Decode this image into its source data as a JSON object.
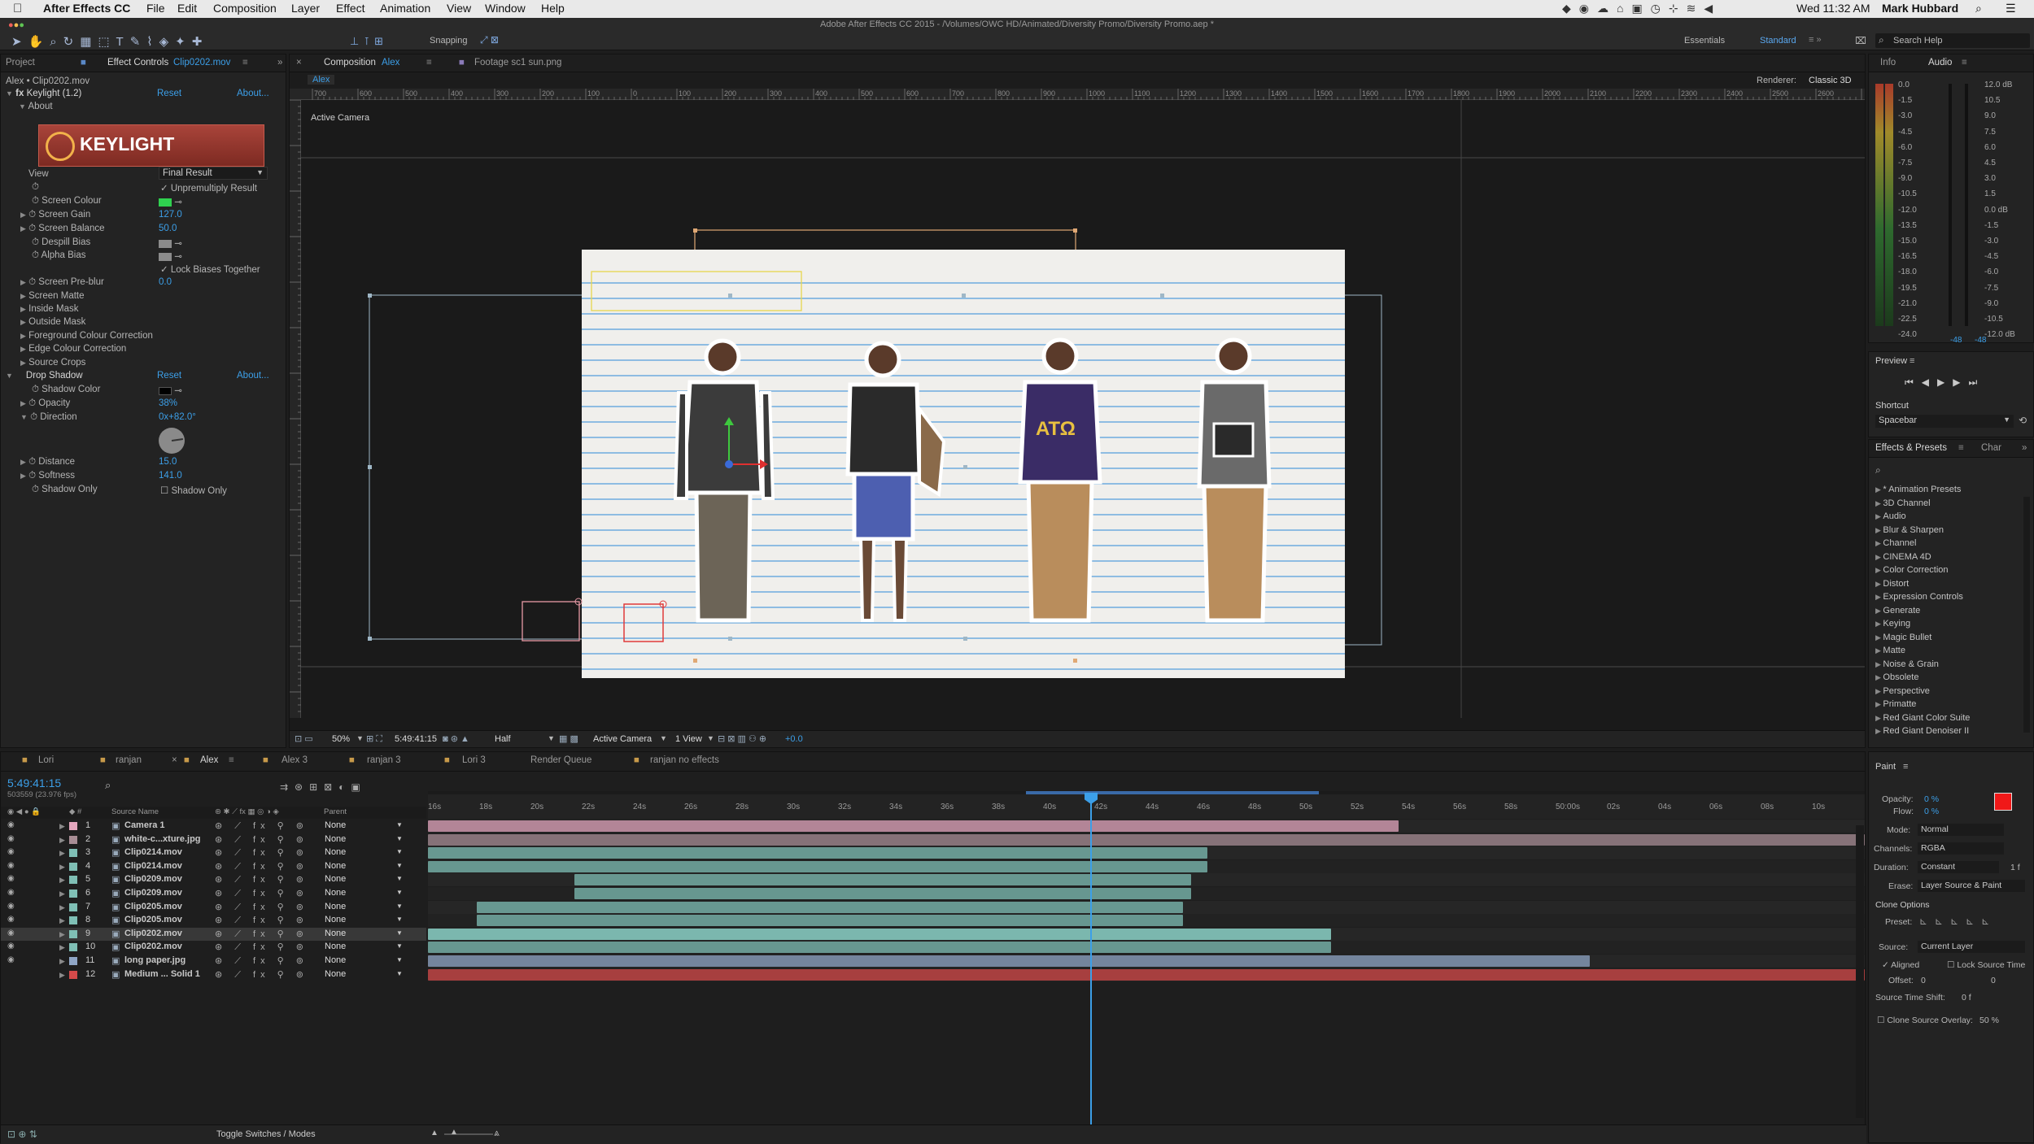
{
  "menubar": {
    "app_name": "After Effects CC",
    "items": [
      "File",
      "Edit",
      "Composition",
      "Layer",
      "Effect",
      "Animation",
      "View",
      "Window",
      "Help"
    ],
    "clock": "Wed 11:32 AM",
    "user": "Mark Hubbard"
  },
  "window_title": "Adobe After Effects CC 2015 - /Volumes/OWC HD/Animated/Diversity Promo/Diversity Promo.aep *",
  "toolbar": {
    "snapping_label": "Snapping",
    "workspaces": [
      "Essentials",
      "Standard"
    ],
    "search_placeholder": "Search Help"
  },
  "left_panel": {
    "tabs": [
      "Project",
      "Effect Controls",
      "Clip0202.mov"
    ],
    "breadcrumb": "Alex • Clip0202.mov",
    "keylight": {
      "name": "Keylight (1.2)",
      "reset": "Reset",
      "about": "About...",
      "about_group": "About",
      "logo_text": "KEYLIGHT",
      "view_label": "View",
      "view_value": "Final Result",
      "unpremultiply": "Unpremultiply Result",
      "screen_colour": "Screen Colour",
      "screen_gain": "Screen Gain",
      "screen_gain_value": "127.0",
      "screen_balance": "Screen Balance",
      "screen_balance_value": "50.0",
      "despill_bias": "Despill Bias",
      "alpha_bias": "Alpha Bias",
      "lock_biases": "Lock Biases Together",
      "screen_preblur": "Screen Pre-blur",
      "screen_preblur_value": "0.0",
      "groups": [
        "Screen Matte",
        "Inside Mask",
        "Outside Mask",
        "Foreground Colour Correction",
        "Edge Colour Correction",
        "Source Crops"
      ]
    },
    "drop_shadow": {
      "name": "Drop Shadow",
      "reset": "Reset",
      "about": "About...",
      "shadow_color": "Shadow Color",
      "opacity": "Opacity",
      "opacity_value": "38%",
      "direction": "Direction",
      "direction_value": "0x+82.0°",
      "distance": "Distance",
      "distance_value": "15.0",
      "softness": "Softness",
      "softness_value": "141.0",
      "shadow_only": "Shadow Only",
      "shadow_only_value": "Shadow Only"
    }
  },
  "comp_panel": {
    "tabs": [
      "Composition",
      "Alex",
      "Footage sc1 sun.png"
    ],
    "comp_tab": "Alex",
    "renderer_label": "Renderer:",
    "renderer_value": "Classic 3D",
    "active_camera": "Active Camera",
    "ruler_labels": [
      "700",
      "600",
      "500",
      "400",
      "300",
      "200",
      "100",
      "0",
      "100",
      "200",
      "300",
      "400",
      "500",
      "600",
      "700",
      "800",
      "900",
      "1000",
      "1100",
      "1200",
      "1300",
      "1400",
      "1500",
      "1600",
      "1700",
      "1800",
      "1900",
      "2000",
      "2100",
      "2200",
      "2300",
      "2400",
      "2500",
      "2600"
    ],
    "footer": {
      "zoom": "50%",
      "timecode": "5:49:41:15",
      "resolution": "Half",
      "view": "Active Camera",
      "views": "1 View",
      "exposure": "+0.0"
    }
  },
  "right_panel": {
    "info_tabs": [
      "Info",
      "Audio"
    ],
    "audio_levels": [
      "0.0",
      "-1.5",
      "-3.0",
      "-4.5",
      "-6.0",
      "-7.5",
      "-9.0",
      "-10.5",
      "-12.0",
      "-13.5",
      "-15.0",
      "-16.5",
      "-18.0",
      "-19.5",
      "-21.0",
      "-22.5",
      "-24.0"
    ],
    "audio_db": [
      "12.0 dB",
      "10.5",
      "9.0",
      "7.5",
      "6.0",
      "4.5",
      "3.0",
      "1.5",
      "0.0 dB",
      "-1.5",
      "-3.0",
      "-4.5",
      "-6.0",
      "-7.5",
      "-9.0",
      "-10.5",
      "-12.0 dB"
    ],
    "peak_left": "-48",
    "peak_right": "-48",
    "preview_title": "Preview",
    "shortcut_label": "Shortcut",
    "shortcut_value": "Spacebar",
    "effects_tabs": [
      "Effects & Presets",
      "Char"
    ],
    "effects_list": [
      "* Animation Presets",
      "3D Channel",
      "Audio",
      "Blur & Sharpen",
      "Channel",
      "CINEMA 4D",
      "Color Correction",
      "Distort",
      "Expression Controls",
      "Generate",
      "Keying",
      "Magic Bullet",
      "Matte",
      "Noise & Grain",
      "Obsolete",
      "Perspective",
      "Primatte",
      "Red Giant Color Suite",
      "Red Giant Denoiser II"
    ],
    "paint": {
      "title": "Paint",
      "opacity_label": "Opacity:",
      "opacity_value": "0 %",
      "flow_label": "Flow:",
      "flow_value": "0 %",
      "mode_label": "Mode:",
      "mode_value": "Normal",
      "channels_label": "Channels:",
      "channels_value": "RGBA",
      "duration_label": "Duration:",
      "duration_value": "Constant",
      "duration_frames": "1 f",
      "erase_label": "Erase:",
      "erase_value": "Layer Source & Paint",
      "clone_options": "Clone Options",
      "preset_label": "Preset:",
      "source_label": "Source:",
      "source_value": "Current Layer",
      "aligned": "Aligned",
      "lock_source_time": "Lock Source Time",
      "offset_label": "Offset:",
      "offset_x": "0",
      "offset_y": "0",
      "source_time_shift": "Source Time Shift:",
      "source_time_shift_value": "0 f",
      "clone_overlay": "Clone Source Overlay:",
      "clone_overlay_value": "50 %"
    }
  },
  "timeline": {
    "tabs": [
      "Lori",
      "ranjan",
      "Alex",
      "Alex 3",
      "ranjan 3",
      "Lori 3",
      "Render Queue",
      "ranjan no effects"
    ],
    "active_tab": "Alex",
    "timecode": "5:49:41:15",
    "frame_info": "503559 (23.976 fps)",
    "col_source": "Source Name",
    "col_parent": "Parent",
    "time_ticks": [
      "16s",
      "18s",
      "20s",
      "22s",
      "24s",
      "26s",
      "28s",
      "30s",
      "32s",
      "34s",
      "36s",
      "38s",
      "40s",
      "42s",
      "44s",
      "46s",
      "48s",
      "50s",
      "52s",
      "54s",
      "56s",
      "58s",
      "50:00s",
      "02s",
      "04s",
      "06s",
      "08s",
      "10s"
    ],
    "layers": [
      {
        "num": "1",
        "name": "Camera 1",
        "parent": "None",
        "color": "#e3a6bd"
      },
      {
        "num": "2",
        "name": "white-c...xture.jpg",
        "parent": "None",
        "color": "#a88d95"
      },
      {
        "num": "3",
        "name": "Clip0214.mov",
        "parent": "None",
        "color": "#7fbfb5"
      },
      {
        "num": "4",
        "name": "Clip0214.mov",
        "parent": "None",
        "color": "#7fbfb5"
      },
      {
        "num": "5",
        "name": "Clip0209.mov",
        "parent": "None",
        "color": "#7fbfb5"
      },
      {
        "num": "6",
        "name": "Clip0209.mov",
        "parent": "None",
        "color": "#7fbfb5"
      },
      {
        "num": "7",
        "name": "Clip0205.mov",
        "parent": "None",
        "color": "#7fbfb5"
      },
      {
        "num": "8",
        "name": "Clip0205.mov",
        "parent": "None",
        "color": "#7fbfb5"
      },
      {
        "num": "9",
        "name": "Clip0202.mov",
        "parent": "None",
        "color": "#7fbfb5"
      },
      {
        "num": "10",
        "name": "Clip0202.mov",
        "parent": "None",
        "color": "#7fbfb5"
      },
      {
        "num": "11",
        "name": "long paper.jpg",
        "parent": "None",
        "color": "#8fa6c6"
      },
      {
        "num": "12",
        "name": "Medium ... Solid 1",
        "parent": "None",
        "color": "#d44a4a"
      }
    ],
    "toggle_label": "Toggle Switches / Modes"
  }
}
